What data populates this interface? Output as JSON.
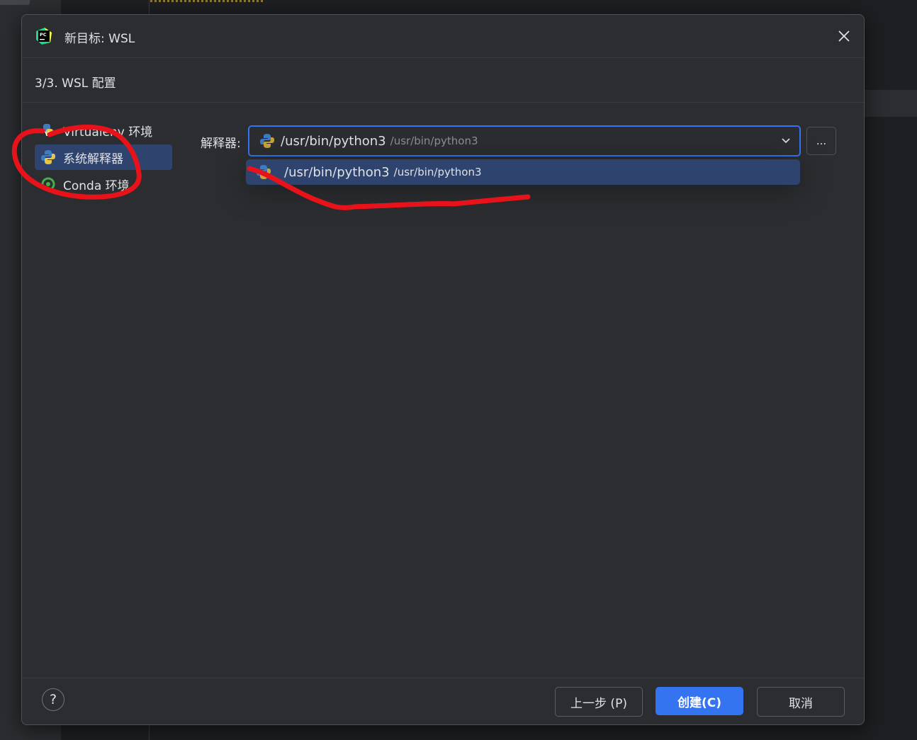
{
  "dialog": {
    "title": "新目标: WSL",
    "step_title": "3/3. WSL 配置"
  },
  "sidebar": {
    "items": [
      {
        "label": "Virtualenv 环境",
        "icon": "virtualenv-icon"
      },
      {
        "label": "系统解释器",
        "icon": "python-icon",
        "selected": true
      },
      {
        "label": "Conda 环境",
        "icon": "conda-icon"
      }
    ]
  },
  "interpreter": {
    "label": "解释器:",
    "value": "/usr/bin/python3",
    "value_path": "/usr/bin/python3",
    "browse_label": "..."
  },
  "dropdown": {
    "options": [
      {
        "name": "/usr/bin/python3",
        "path": "/usr/bin/python3",
        "highlighted": true
      }
    ]
  },
  "footer": {
    "help_label": "?",
    "prev_label": "上一步 (P)",
    "create_label": "创建(C)",
    "cancel_label": "取消"
  },
  "colors": {
    "accent": "#3574f0",
    "selection": "#2e436e",
    "annotation": "#e8131a"
  }
}
